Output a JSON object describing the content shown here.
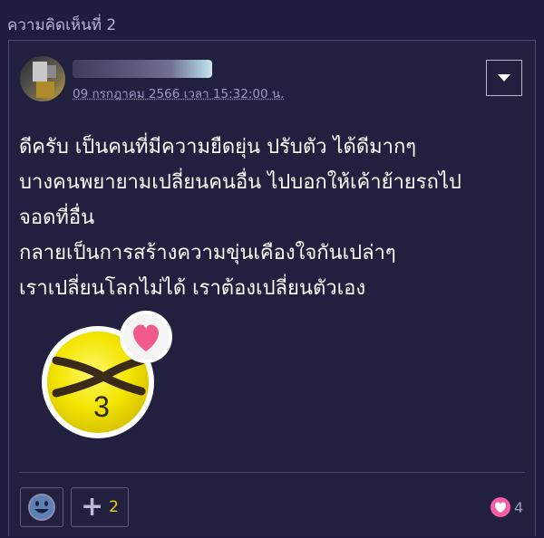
{
  "section_title": "ความคิดเห็นที่ 2",
  "comment": {
    "timestamp": "09 กรกฎาคม 2566 เวลา 15:32:00 น.",
    "lines": [
      "ดีครับ เป็นคนที่มีความยืดยุ่น ปรับตัว ได้ดีมากๆ",
      "บางคนพยายามเปลี่ยนคนอื่น ไปบอกให้เค้าย้ายรถไป",
      "จอดที่อื่น",
      "กลายเป็นการสร้างความขุ่นเคืองใจกันเปล่าๆ",
      "เราเปลี่ยนโลกไม่ได้ เราต้องเปลี่ยนตัวเอง"
    ],
    "sticker": {
      "icon": "x-eyes-smiley-sticker",
      "number": "3"
    }
  },
  "footer": {
    "plus_count": "2",
    "like_count": "4"
  },
  "colors": {
    "background": "#1f1d3d",
    "accent_heart": "#f15fa5",
    "count_yellow": "#f5d300",
    "muted_text": "#9f98c4"
  },
  "icons": {
    "menu": "chevron-down-icon",
    "emoji": "smiley-icon",
    "plus": "plus-icon",
    "like": "heart-icon"
  }
}
